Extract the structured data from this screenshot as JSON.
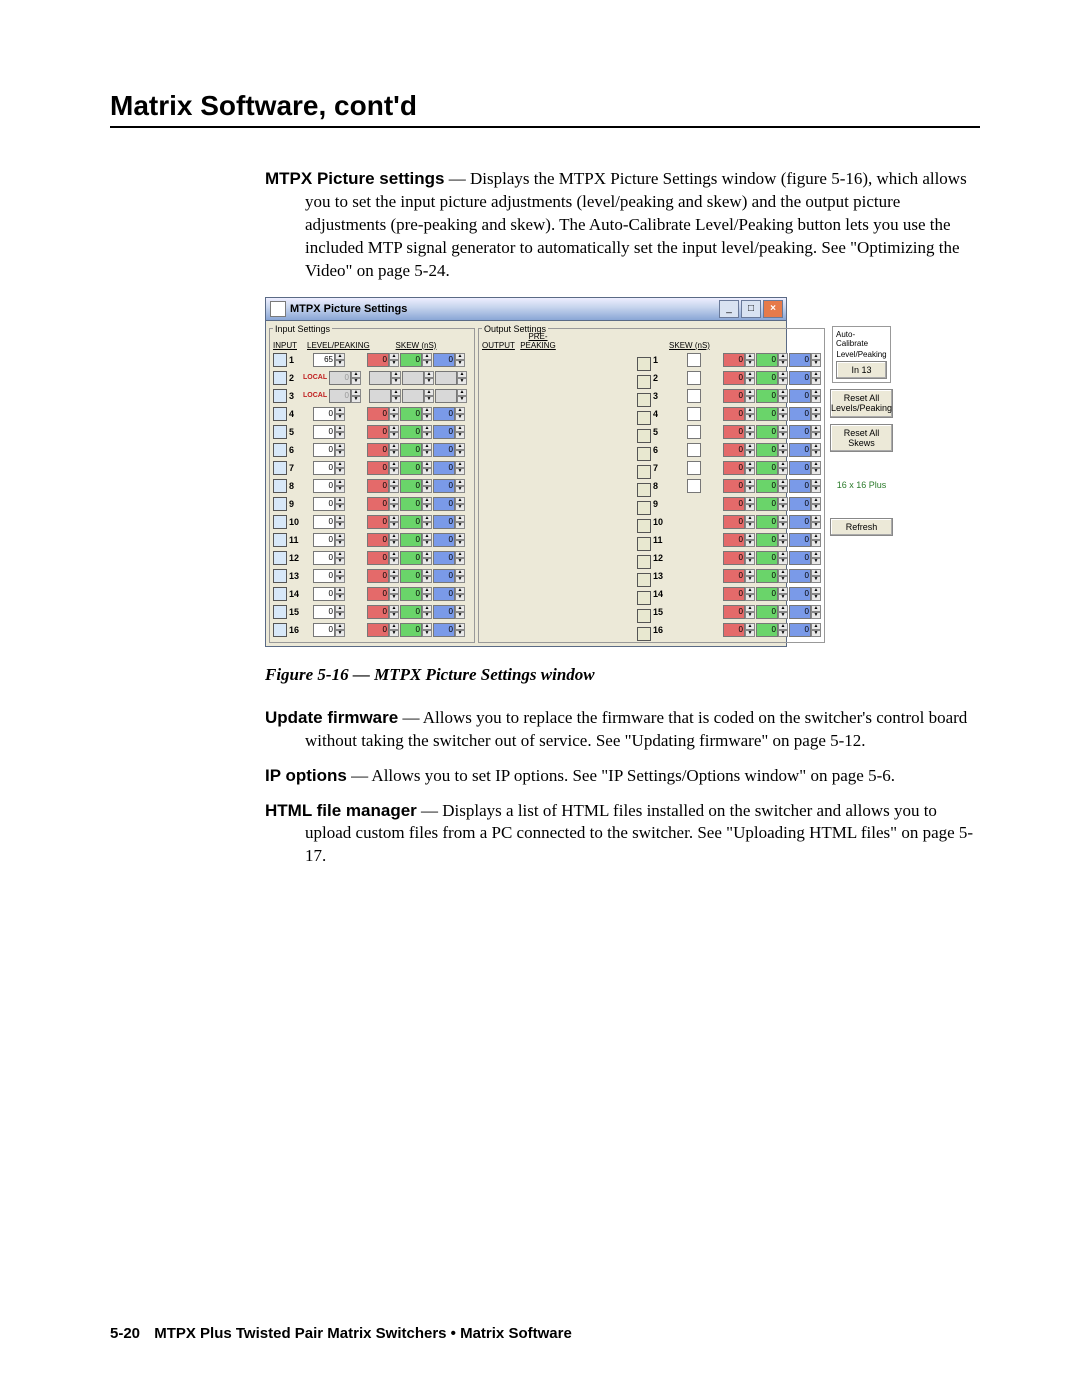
{
  "page": {
    "title": "Matrix Software, cont'd",
    "footer_page": "5-20",
    "footer_text": "MTPX Plus Twisted Pair Matrix Switchers • Matrix Software"
  },
  "body": {
    "p1_lead": "MTPX Picture settings",
    "p1_rest": " — Displays the MTPX Picture Settings window (figure 5-16), which allows you to set the input picture adjustments (level/peaking and skew) and the output picture adjustments (pre-peaking and skew).  The Auto-Calibrate Level/Peaking button lets you use the included MTP signal generator to automatically set the input level/peaking.  See \"Optimizing the Video\" on page 5-24.",
    "caption": "Figure 5-16 — MTPX Picture Settings window",
    "p2_lead": "Update firmware",
    "p2_rest": " — Allows you to replace the firmware that is coded on the switcher's control board without taking the switcher out of service.  See \"Updating firmware\" on page 5-12.",
    "p3_lead": "IP options",
    "p3_rest": " — Allows you to set IP options.  See \"IP Settings/Options window\" on page 5-6.",
    "p4_lead": "HTML file manager",
    "p4_rest": " — Displays a list of HTML files installed on the switcher and allows you to upload custom files from a PC connected to the switcher.  See \"Uploading HTML files\" on page 5-17."
  },
  "window": {
    "title": "MTPX Picture Settings",
    "minimize_label": "_",
    "maximize_label": "□",
    "close_label": "×",
    "input_settings": {
      "legend": "Input Settings",
      "h_input": "INPUT",
      "h_level": "LEVEL/PEAKING",
      "h_skew": "SKEW (nS)",
      "rows": [
        {
          "n": "1",
          "level": "65",
          "skewR": "0",
          "skewG": "0",
          "skewB": "0",
          "local": false
        },
        {
          "n": "2",
          "level": "0",
          "skewR": "",
          "skewG": "",
          "skewB": "",
          "local": true
        },
        {
          "n": "3",
          "level": "0",
          "skewR": "",
          "skewG": "",
          "skewB": "",
          "local": true
        },
        {
          "n": "4",
          "level": "0",
          "skewR": "0",
          "skewG": "0",
          "skewB": "0",
          "local": false
        },
        {
          "n": "5",
          "level": "0",
          "skewR": "0",
          "skewG": "0",
          "skewB": "0",
          "local": false
        },
        {
          "n": "6",
          "level": "0",
          "skewR": "0",
          "skewG": "0",
          "skewB": "0",
          "local": false
        },
        {
          "n": "7",
          "level": "0",
          "skewR": "0",
          "skewG": "0",
          "skewB": "0",
          "local": false
        },
        {
          "n": "8",
          "level": "0",
          "skewR": "0",
          "skewG": "0",
          "skewB": "0",
          "local": false
        },
        {
          "n": "9",
          "level": "0",
          "skewR": "0",
          "skewG": "0",
          "skewB": "0",
          "local": false
        },
        {
          "n": "10",
          "level": "0",
          "skewR": "0",
          "skewG": "0",
          "skewB": "0",
          "local": false
        },
        {
          "n": "11",
          "level": "0",
          "skewR": "0",
          "skewG": "0",
          "skewB": "0",
          "local": false
        },
        {
          "n": "12",
          "level": "0",
          "skewR": "0",
          "skewG": "0",
          "skewB": "0",
          "local": false
        },
        {
          "n": "13",
          "level": "0",
          "skewR": "0",
          "skewG": "0",
          "skewB": "0",
          "local": false
        },
        {
          "n": "14",
          "level": "0",
          "skewR": "0",
          "skewG": "0",
          "skewB": "0",
          "local": false
        },
        {
          "n": "15",
          "level": "0",
          "skewR": "0",
          "skewG": "0",
          "skewB": "0",
          "local": false
        },
        {
          "n": "16",
          "level": "0",
          "skewR": "0",
          "skewG": "0",
          "skewB": "0",
          "local": false
        }
      ],
      "local_label": "LOCAL"
    },
    "output_settings": {
      "legend": "Output Settings",
      "h_output": "OUTPUT",
      "h_prepeak": "PRE-PEAKING",
      "h_skew": "SKEW (nS)",
      "rows": [
        {
          "n": "1",
          "chk": false,
          "skewR": "0",
          "skewG": "0",
          "skewB": "0"
        },
        {
          "n": "2",
          "chk": false,
          "skewR": "0",
          "skewG": "0",
          "skewB": "0"
        },
        {
          "n": "3",
          "chk": false,
          "skewR": "0",
          "skewG": "0",
          "skewB": "0"
        },
        {
          "n": "4",
          "chk": false,
          "skewR": "0",
          "skewG": "0",
          "skewB": "0"
        },
        {
          "n": "5",
          "chk": false,
          "skewR": "0",
          "skewG": "0",
          "skewB": "0"
        },
        {
          "n": "6",
          "chk": false,
          "skewR": "0",
          "skewG": "0",
          "skewB": "0"
        },
        {
          "n": "7",
          "chk": false,
          "skewR": "0",
          "skewG": "0",
          "skewB": "0"
        },
        {
          "n": "8",
          "chk": false,
          "skewR": "0",
          "skewG": "0",
          "skewB": "0"
        },
        {
          "n": "9",
          "chk": false,
          "skewR": "0",
          "skewG": "0",
          "skewB": "0"
        },
        {
          "n": "10",
          "chk": false,
          "skewR": "0",
          "skewG": "0",
          "skewB": "0"
        },
        {
          "n": "11",
          "chk": false,
          "skewR": "0",
          "skewG": "0",
          "skewB": "0"
        },
        {
          "n": "12",
          "chk": false,
          "skewR": "0",
          "skewG": "0",
          "skewB": "0"
        },
        {
          "n": "13",
          "chk": false,
          "skewR": "0",
          "skewG": "0",
          "skewB": "0"
        },
        {
          "n": "14",
          "chk": false,
          "skewR": "0",
          "skewG": "0",
          "skewB": "0"
        },
        {
          "n": "15",
          "chk": false,
          "skewR": "0",
          "skewG": "0",
          "skewB": "0"
        },
        {
          "n": "16",
          "chk": false,
          "skewR": "0",
          "skewG": "0",
          "skewB": "0"
        }
      ]
    },
    "side": {
      "auto_cal_legend": "Auto-Calibrate",
      "auto_cal_sub": "Level/Peaking",
      "auto_cal_btn": "In 13",
      "reset_lvl_btn": "Reset All Levels/Peaking",
      "reset_skew_btn": "Reset All Skews",
      "device": "16 x 16 Plus",
      "refresh_btn": "Refresh"
    }
  }
}
